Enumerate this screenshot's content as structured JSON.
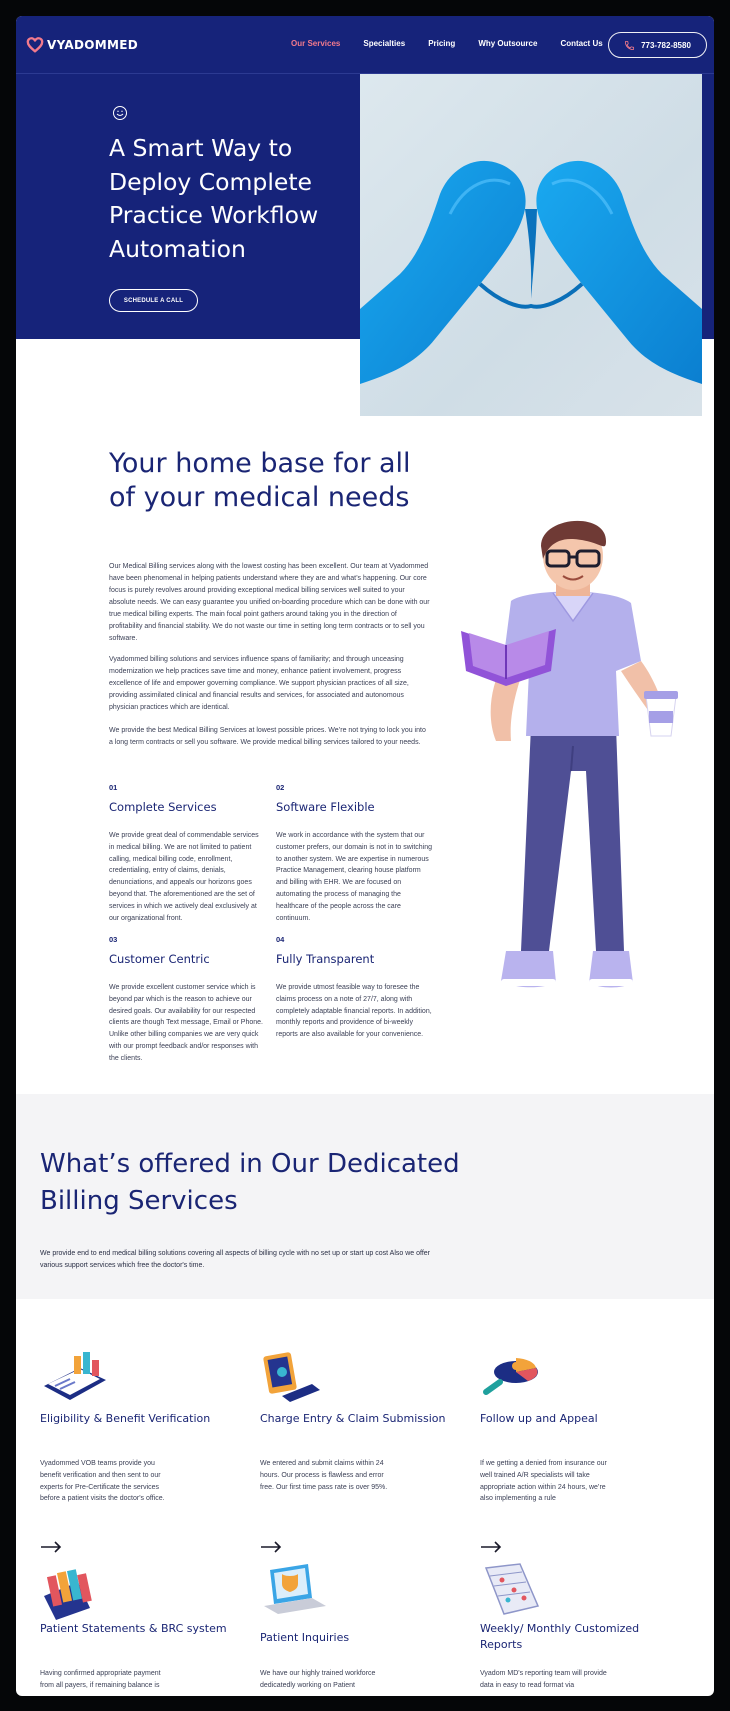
{
  "brand": {
    "name": "VYADOMMED",
    "accent": "#f27a8c",
    "navy": "#16237a"
  },
  "nav": {
    "items": [
      {
        "label": "Our Services"
      },
      {
        "label": "Specialties"
      },
      {
        "label": "Pricing"
      },
      {
        "label": "Why Outsource"
      },
      {
        "label": "Contact Us"
      }
    ],
    "phone": "773-782-8580"
  },
  "hero": {
    "title": "A Smart Way to Deploy Complete Practice Workflow Automation",
    "cta": "SCHEDULE A CALL"
  },
  "home": {
    "title": "Your home base for all of your medical needs",
    "paragraphs": [
      "Our Medical Billing services along with the lowest costing has been excellent. Our team at Vyadommed have been phenomenal in helping patients understand where they are and what’s happening. Our core focus is purely revolves around providing exceptional medical billing services well suited to your absolute needs. We can easy guarantee you unified on-boarding procedure which can be done with our true medical billing experts. The main focal point gathers around taking you in the direction of profitability and financial stability. We do not waste our time in setting long term contracts or to sell you software.",
      "Vyadommed billing solutions and services influence spans of familiarity; and through unceasing modernization we help practices save time and money, enhance patient involvement, progress excellence of life and empower governing compliance. We support physician practices of all size, providing assimilated clinical and financial results and services, for associated and autonomous physician practices which are identical.",
      "We provide the best Medical Billing Services at lowest possible prices. We’re not trying to lock you into a long term contracts or sell you software. We provide medical billing services tailored to your needs."
    ],
    "features": [
      {
        "num": "01",
        "title": "Complete Services",
        "body": "We provide great deal of commendable services in medical billing. We are not limited to patient calling, medical billing code, enrollment, credentialing, entry of claims, denials, denunciations, and appeals our horizons goes beyond that. The aforementioned are the set of services in which we actively deal exclusively at our organizational front."
      },
      {
        "num": "02",
        "title": "Software Flexible",
        "body": "We work in accordance with the system that our customer prefers, our domain is not in to switching to another system. We are expertise in numerous Practice Management, clearing house platform and billing with EHR. We are focused on automating the process of managing the healthcare of the people across the care continuum."
      },
      {
        "num": "03",
        "title": "Customer Centric",
        "body": "We provide excellent customer service which is beyond par which is the reason to achieve our desired goals. Our availability for our respected clients are though Text message, Email or Phone. Unlike other billing companies we are very quick with our prompt feedback and/or responses with the clients."
      },
      {
        "num": "04",
        "title": "Fully Transparent",
        "body": "We provide utmost feasible way to foresee the claims process on a note of 27/7, along with completely adaptable financial reports. In addition, monthly reports and providence of bi-weekly reports are also available for your convenience."
      }
    ]
  },
  "offered": {
    "title": "What’s offered in Our Dedicated Billing Services",
    "description": "We provide end to end medical billing solutions covering all aspects of billing cycle with no set up or start up cost Also we offer various support services which free the doctor's time."
  },
  "services": [
    {
      "icon": "clipboard-chart-icon",
      "title": "Eligibility & Benefit Verification",
      "body": "Vyadommed VOB teams provide you benefit verification and then sent to our experts for Pre-Certificate the services before a patient visits the doctor's office."
    },
    {
      "icon": "monitor-card-icon",
      "title": "Charge Entry & Claim Submission",
      "body": "We entered and submit claims within 24 hours. Our process is flawless and error free. Our first time pass rate is over 95%."
    },
    {
      "icon": "magnifier-pie-icon",
      "title": "Follow up and Appeal",
      "body": "If we getting a denied from insurance our well trained A/R specialists will take appropriate action within 24 hours, we’re also implementing a rule"
    },
    {
      "icon": "folders-icon",
      "title": "Patient Statements & BRC system",
      "body": "Having confirmed appropriate payment from all payers, if remaining balance is"
    },
    {
      "icon": "laptop-shield-icon",
      "title": "Patient Inquiries",
      "body": "We have our highly trained workforce dedicatedly working on Patient"
    },
    {
      "icon": "calendar-report-icon",
      "title": "Weekly/ Monthly Customized Reports",
      "body": "Vyadom MD's reporting team will provide data in easy to read format via"
    }
  ]
}
